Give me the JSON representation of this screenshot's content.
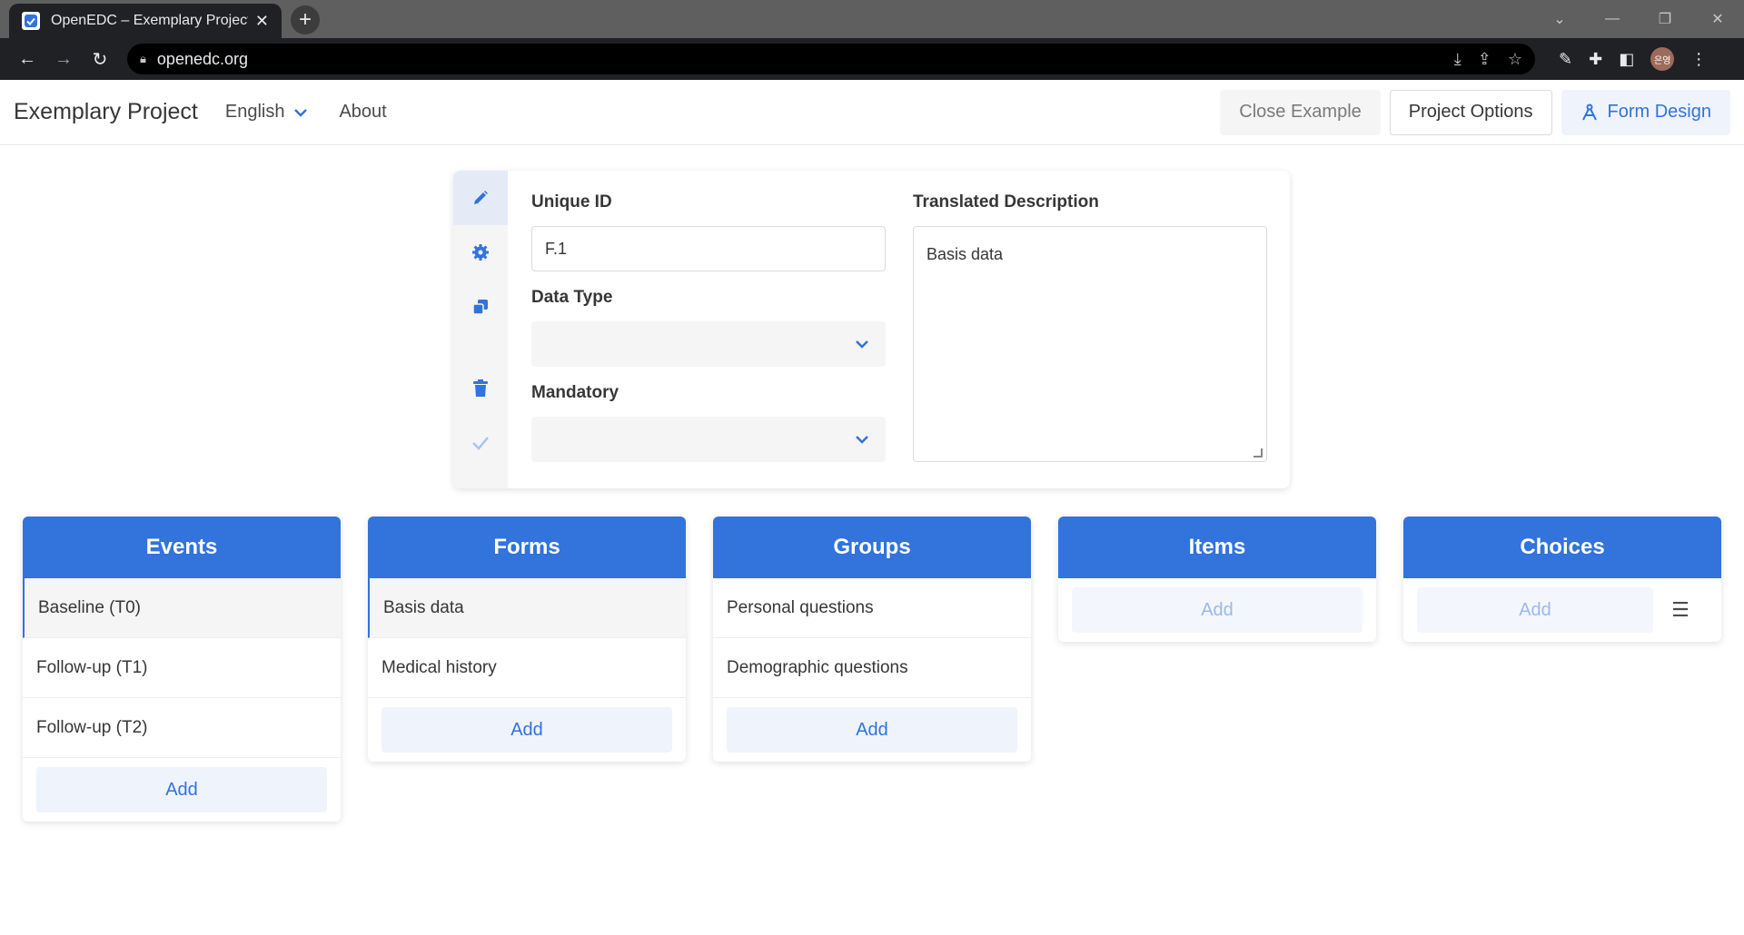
{
  "browser": {
    "tab_title": "OpenEDC – Exemplary Project",
    "url": "openedc.org",
    "avatar_text": "은영"
  },
  "header": {
    "brand": "Exemplary Project",
    "language": "English",
    "about": "About",
    "close_example": "Close Example",
    "project_options": "Project Options",
    "form_design": "Form Design"
  },
  "editor": {
    "unique_id_label": "Unique ID",
    "unique_id_value": "F.1",
    "data_type_label": "Data Type",
    "data_type_value": "",
    "mandatory_label": "Mandatory",
    "mandatory_value": "",
    "translated_description_label": "Translated Description",
    "translated_description_value": "Basis data"
  },
  "columns": {
    "events": {
      "title": "Events",
      "items": [
        "Baseline (T0)",
        "Follow-up (T1)",
        "Follow-up (T2)"
      ],
      "add": "Add"
    },
    "forms": {
      "title": "Forms",
      "items": [
        "Basis data",
        "Medical history"
      ],
      "add": "Add"
    },
    "groups": {
      "title": "Groups",
      "items": [
        "Personal questions",
        "Demographic questions"
      ],
      "add": "Add"
    },
    "items": {
      "title": "Items",
      "items": [],
      "add": "Add"
    },
    "choices": {
      "title": "Choices",
      "items": [],
      "add": "Add"
    }
  },
  "colors": {
    "primary": "#3273dc",
    "primary_light": "#eef3fc"
  }
}
